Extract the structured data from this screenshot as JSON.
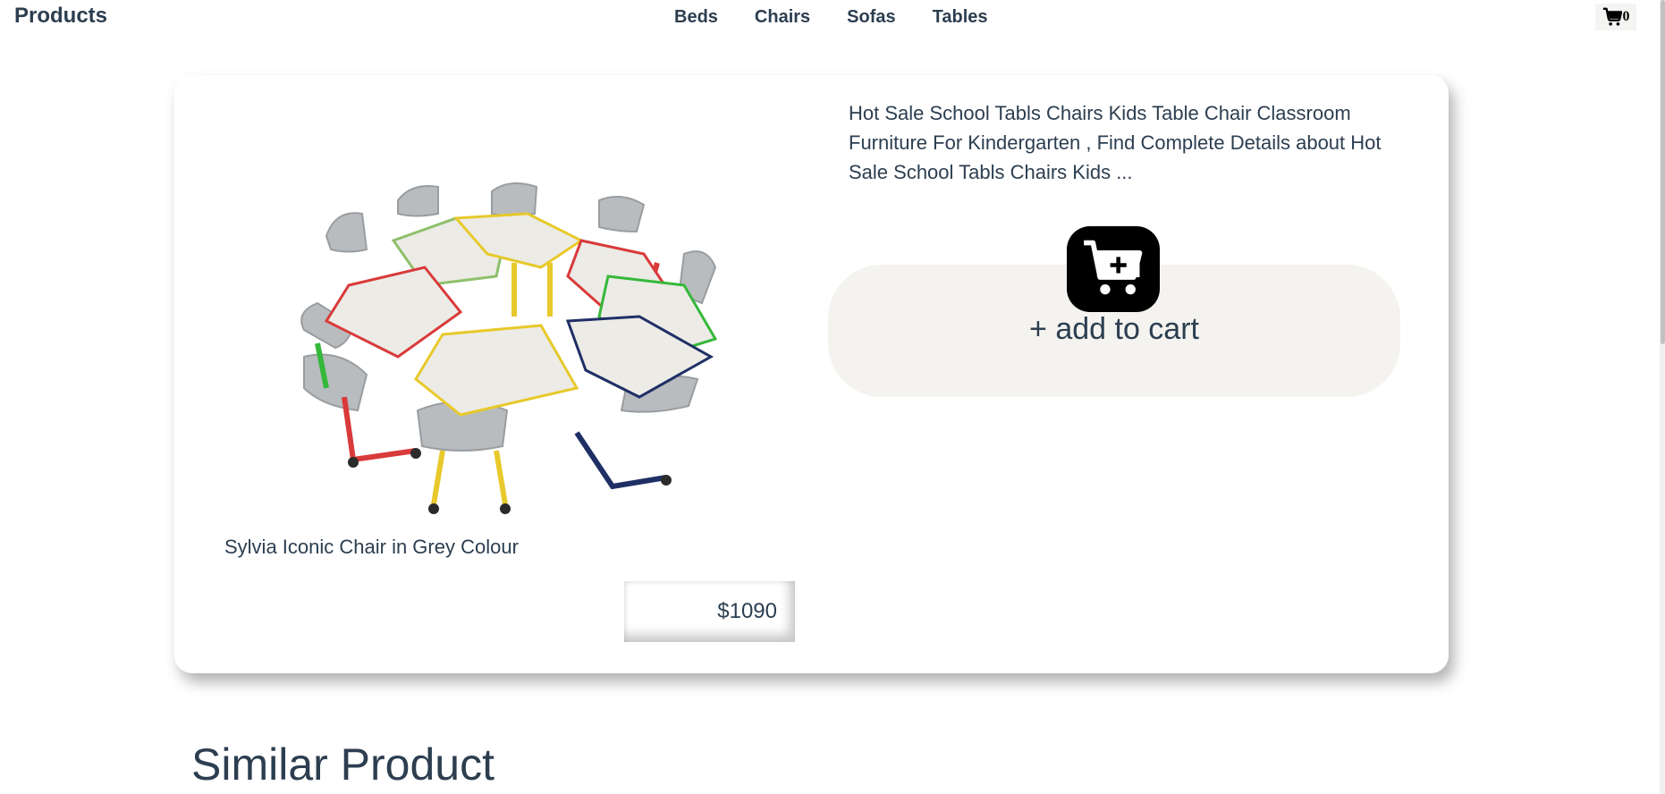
{
  "navbar": {
    "brand": "Products",
    "links": [
      "Beds",
      "Chairs",
      "Sofas",
      "Tables"
    ],
    "cart_count": "0"
  },
  "product": {
    "name": "Sylvia Iconic Chair in Grey Colour",
    "price": "$1090",
    "description": "Hot Sale School Tabls Chairs Kids Table Chair Classroom Furniture For Kindergarten , Find Complete Details about Hot Sale School Tabls Chairs Kids ...",
    "add_to_cart_label": "+ add to cart",
    "image_icon": "classroom-table-chairs-image"
  },
  "similar": {
    "title": "Similar Product"
  },
  "colors": {
    "text": "#2c3e50",
    "panel": "#f4f3ef",
    "accent": "#000000"
  }
}
